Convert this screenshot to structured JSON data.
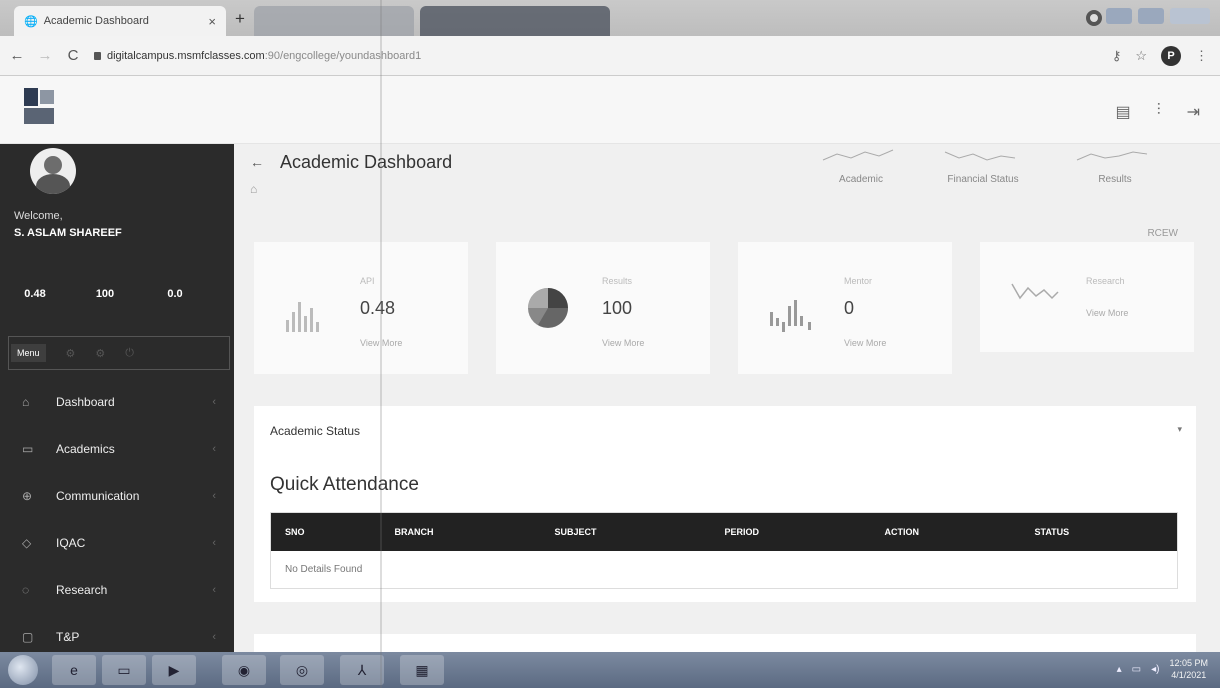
{
  "browser": {
    "active_tab": "Academic Dashboard",
    "tab_close": "×",
    "new_tab": "+",
    "url_host": "digitalcampus.msmfclasses.com",
    "url_path": ":90/engcollege/youndashboard1",
    "profile_initial": "P"
  },
  "sidebar": {
    "welcome": "Welcome,",
    "user_name": "S. ASLAM SHAREEF",
    "stats": [
      {
        "value": "0.48"
      },
      {
        "value": "100"
      },
      {
        "value": "0.0"
      }
    ],
    "menu_label": "Menu",
    "items": [
      {
        "label": "Dashboard",
        "icon": "home-icon"
      },
      {
        "label": "Academics",
        "icon": "folder-icon"
      },
      {
        "label": "Communication",
        "icon": "globe-icon"
      },
      {
        "label": "IQAC",
        "icon": "diamond-icon"
      },
      {
        "label": "Research",
        "icon": "tag-icon"
      },
      {
        "label": "T&P",
        "icon": "clipboard-icon"
      }
    ]
  },
  "main": {
    "title": "Academic Dashboard",
    "quick_links": [
      "Academic",
      "Financial Status",
      "Results"
    ],
    "college": "RCEW",
    "cards": [
      {
        "title": "API",
        "value": "0.48",
        "link": "View More"
      },
      {
        "title": "Results",
        "value": "100",
        "link": "View More"
      },
      {
        "title": "Mentor",
        "value": "0",
        "link": "View More"
      },
      {
        "title": "Research",
        "link": "View More"
      }
    ],
    "academic_status": "Academic Status",
    "quick_attendance": "Quick Attendance",
    "table": {
      "headers": [
        "SNO",
        "BRANCH",
        "SUBJECT",
        "PERIOD",
        "ACTION",
        "STATUS"
      ],
      "empty_text": "No Details Found"
    }
  },
  "taskbar": {
    "time": "12:05 PM",
    "date": "4/1/2021"
  },
  "colors": {
    "sidebar_bg": "#2b2b2b",
    "table_header_bg": "#222222",
    "content_bg": "#f0f0f0"
  }
}
